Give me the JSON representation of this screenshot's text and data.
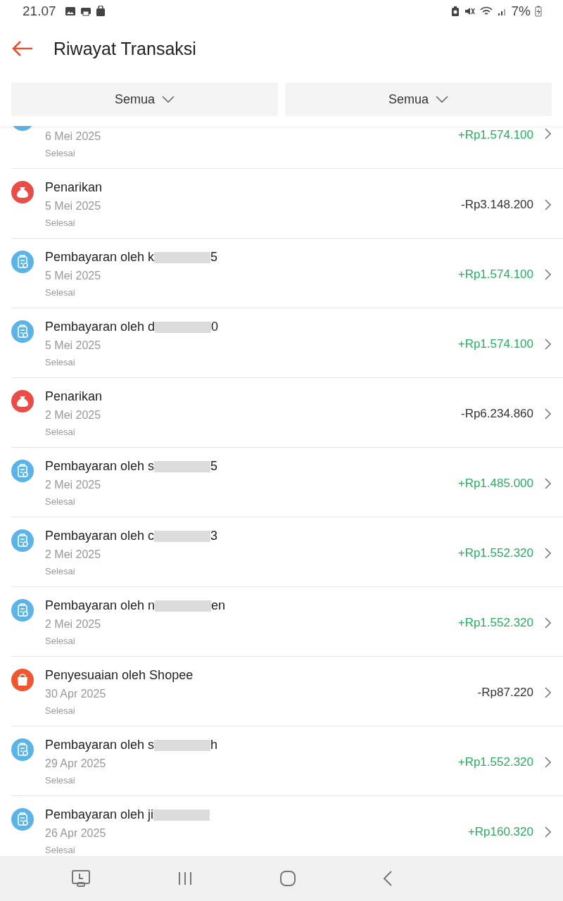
{
  "status_bar": {
    "time": "21.07",
    "battery": "7%"
  },
  "header": {
    "title": "Riwayat Transaksi"
  },
  "filters": [
    {
      "label": "Semua"
    },
    {
      "label": "Semua"
    }
  ],
  "transactions": [
    {
      "kind": "payment",
      "partial": true,
      "date": "6 Mei 2025",
      "status": "Selesai",
      "amount": "+Rp1.574.100",
      "credit": true
    },
    {
      "kind": "withdrawal",
      "title": "Penarikan",
      "date": "5 Mei 2025",
      "status": "Selesai",
      "amount": "-Rp3.148.200",
      "credit": false
    },
    {
      "kind": "payment",
      "title": "Pembayaran oleh k",
      "redacted": true,
      "title_end": "5",
      "date": "5 Mei 2025",
      "status": "Selesai",
      "amount": "+Rp1.574.100",
      "credit": true
    },
    {
      "kind": "payment",
      "title": "Pembayaran oleh d",
      "redacted": true,
      "title_end": "0",
      "date": "5 Mei 2025",
      "status": "Selesai",
      "amount": "+Rp1.574.100",
      "credit": true
    },
    {
      "kind": "withdrawal",
      "title": "Penarikan",
      "date": "2 Mei 2025",
      "status": "Selesai",
      "amount": "-Rp6.234.860",
      "credit": false
    },
    {
      "kind": "payment",
      "title": "Pembayaran oleh s",
      "redacted": true,
      "title_end": "5",
      "date": "2 Mei 2025",
      "status": "Selesai",
      "amount": "+Rp1.485.000",
      "credit": true
    },
    {
      "kind": "payment",
      "title": "Pembayaran oleh c",
      "redacted": true,
      "title_end": "3",
      "date": "2 Mei 2025",
      "status": "Selesai",
      "amount": "+Rp1.552.320",
      "credit": true
    },
    {
      "kind": "payment",
      "title": "Pembayaran oleh n",
      "redacted": true,
      "title_end": "en",
      "date": "2 Mei 2025",
      "status": "Selesai",
      "amount": "+Rp1.552.320",
      "credit": true
    },
    {
      "kind": "adjustment",
      "title": "Penyesuaian oleh Shopee",
      "date": "30 Apr 2025",
      "status": "Selesai",
      "amount": "-Rp87.220",
      "credit": false
    },
    {
      "kind": "payment",
      "title": "Pembayaran oleh s",
      "redacted": true,
      "title_end": "h",
      "date": "29 Apr 2025",
      "status": "Selesai",
      "amount": "+Rp1.552.320",
      "credit": true
    },
    {
      "kind": "payment",
      "title": "Pembayaran oleh ji",
      "redacted": true,
      "date": "26 Apr 2025",
      "status": "Selesai",
      "amount": "+Rp160.320",
      "credit": true
    }
  ]
}
